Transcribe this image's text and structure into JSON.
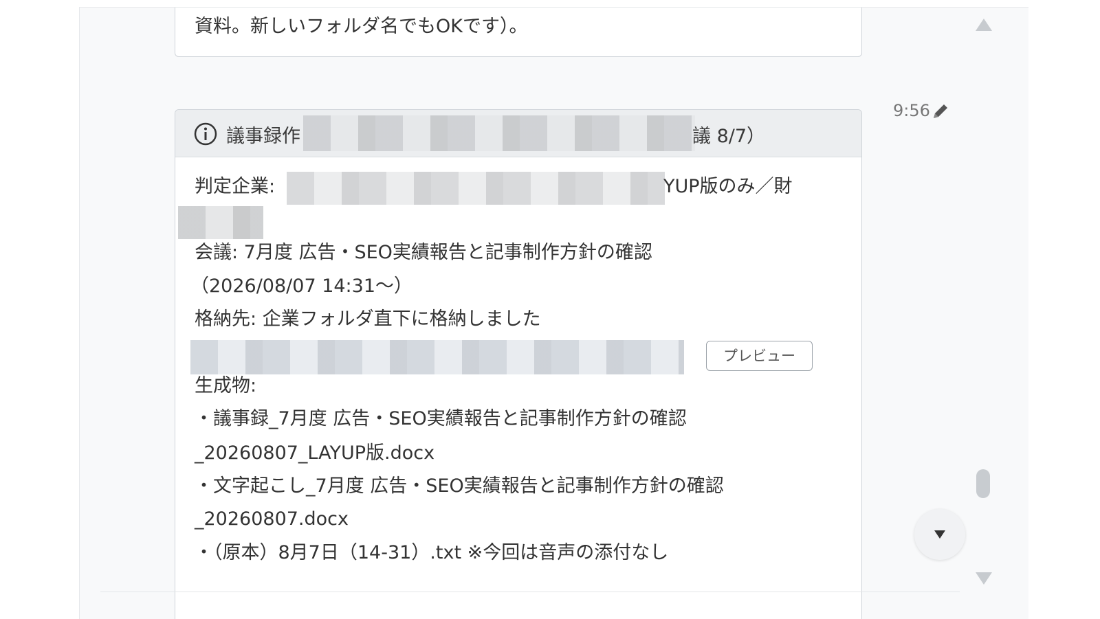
{
  "top_message": {
    "text": "資料。新しいフォルダ名でもOKです）。"
  },
  "message": {
    "time": "9:56",
    "header": {
      "title_prefix": "議事録作",
      "title_suffix": "議 8/7）",
      "icon": "info-icon"
    },
    "company_label": "判定企業:",
    "company_suffix": "YUP版のみ／財",
    "meeting_line": "会議: 7月度 広告・SEO実績報告と記事制作方針の確認",
    "meeting_datetime": "（2026/08/07 14:31〜）",
    "storage_line": "格納先: 企業フォルダ直下に格納しました",
    "preview_label": "プレビュー",
    "outputs_label": "生成物:",
    "outputs": [
      "・議事録_7月度 広告・SEO実績報告と記事制作方針の確認",
      "_20260807_LAYUP版.docx",
      "・文字起こし_7月度 広告・SEO実績報告と記事制作方針の確認",
      "_20260807.docx",
      "・（原本）8月7日（14-31）.txt ※今回は音声の添付なし"
    ]
  },
  "controls": {
    "edit_icon": "pencil-icon",
    "scroll_up_icon": "triangle-up-icon",
    "scroll_down_icon": "triangle-down-icon",
    "jump_icon": "caret-down-icon"
  },
  "colors": {
    "panel_bg": "#f8f9fa",
    "card_border": "#cfd4d9",
    "header_bg": "#eceef0"
  }
}
